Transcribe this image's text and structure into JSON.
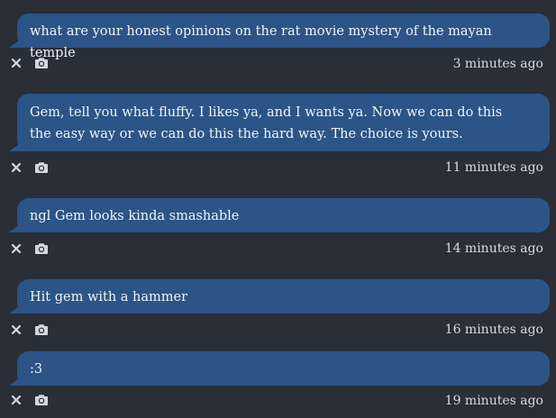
{
  "colors": {
    "background": "#292e38",
    "bubble": "#2c5487",
    "bubble_text": "#f2f4f8",
    "meta_text": "#d7dbe2",
    "icon": "#d4d7dd"
  },
  "messages": [
    {
      "text": "what are your honest opinions on the rat movie mystery of the mayan temple",
      "timestamp": "3 minutes ago",
      "icons": [
        "close-icon",
        "camera-icon"
      ]
    },
    {
      "text": "Gem, tell you what fluffy. I likes ya, and I wants ya. Now we can do this the easy way or we can do this the hard way. The choice is yours.",
      "timestamp": "11 minutes ago",
      "icons": [
        "close-icon",
        "camera-icon"
      ]
    },
    {
      "text": "ngl Gem looks kinda smashable",
      "timestamp": "14 minutes ago",
      "icons": [
        "close-icon",
        "camera-icon"
      ]
    },
    {
      "text": "Hit gem with a hammer",
      "timestamp": "16 minutes ago",
      "icons": [
        "close-icon",
        "camera-icon"
      ]
    },
    {
      "text": ":3",
      "timestamp": "19 minutes ago",
      "icons": [
        "close-icon",
        "camera-icon"
      ]
    }
  ]
}
